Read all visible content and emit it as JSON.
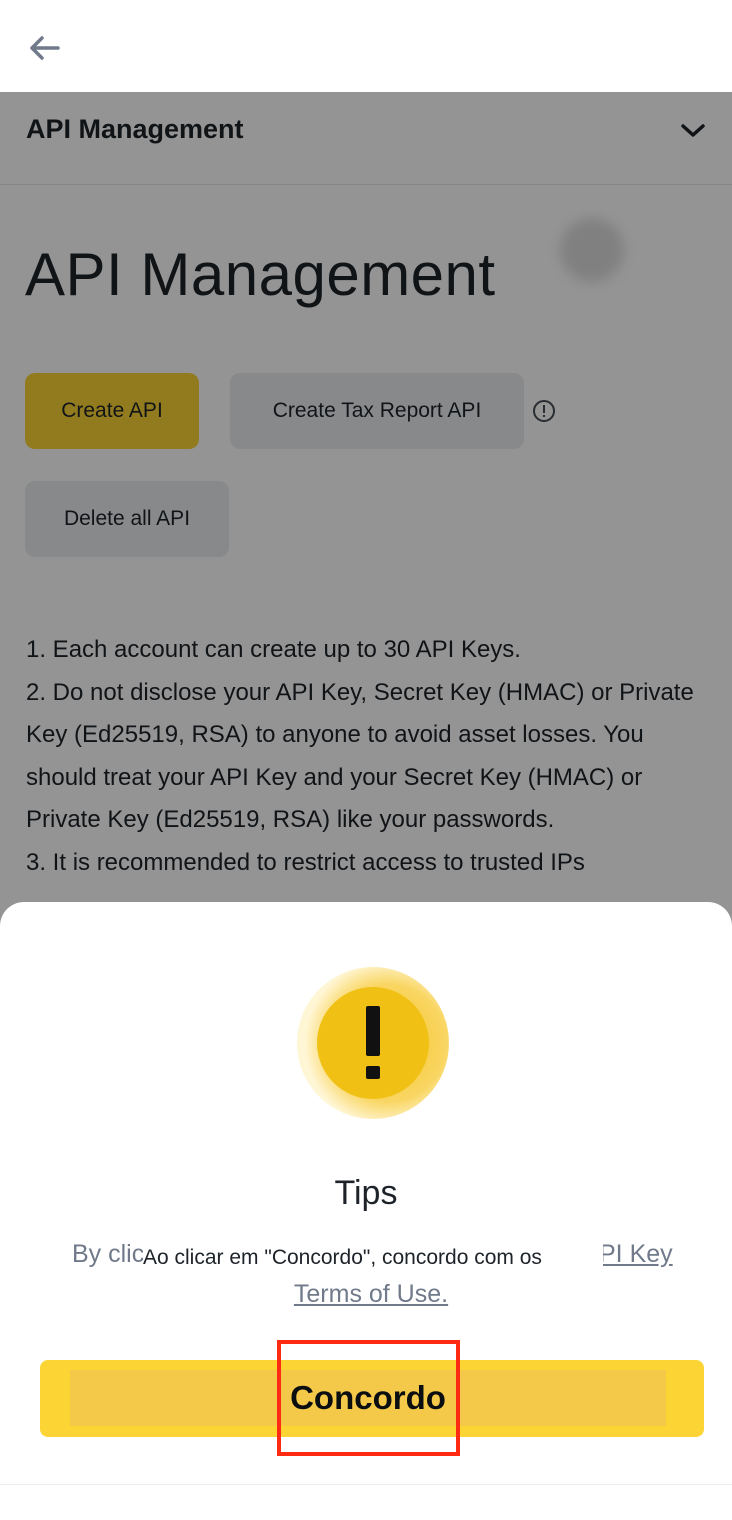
{
  "nav": {
    "back_icon": "arrow-left-icon"
  },
  "section": {
    "title": "API Management",
    "chevron_icon": "chevron-down-icon"
  },
  "page": {
    "title": "API Management",
    "buttons": {
      "create": "Create API",
      "tax": "Create Tax Report API",
      "delete": "Delete all API"
    },
    "info_icon": "info-icon",
    "notes": [
      "1. Each account can create up to 30 API Keys.",
      "2. Do not disclose your API Key, Secret Key (HMAC) or Private Key (Ed25519, RSA) to anyone to avoid asset losses. You should treat your API Key and your Secret Key (HMAC) or Private Key (Ed25519, RSA) like your passwords.",
      "3. It is recommended to restrict access to trusted IPs"
    ]
  },
  "modal": {
    "icon": "warning-icon",
    "title": "Tips",
    "text_visible_start": "By clic",
    "text_translation": "Ao clicar em \"Concordo\", concordo com os",
    "text_visible_tail": "PI Key",
    "link_text": "Terms of Use.",
    "agree_label": "Concordo"
  },
  "colors": {
    "accent": "#FCD535",
    "highlight": "#FF2A12",
    "muted_text": "#707A8A"
  }
}
